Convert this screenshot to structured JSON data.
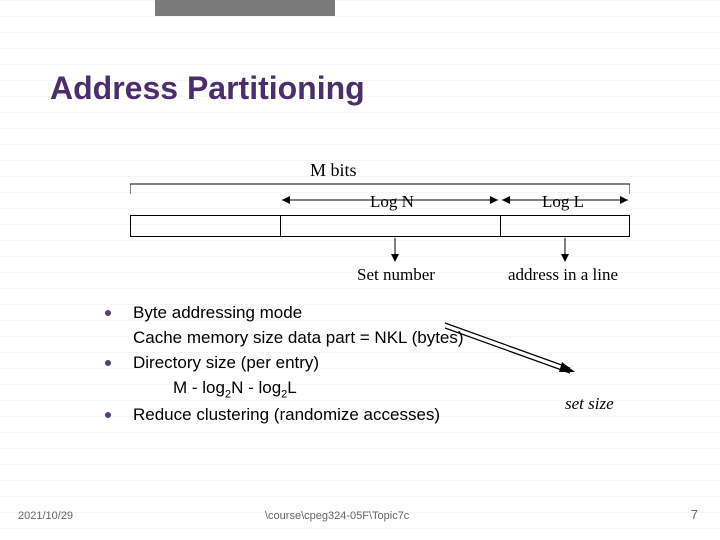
{
  "title": "Address Partitioning",
  "diagram": {
    "total_label": "M bits",
    "field1_label": "Log N",
    "field2_label": "Log L",
    "field1_desc": "Set number",
    "field2_desc": "address in a line"
  },
  "bullets": {
    "b1": "Byte addressing mode",
    "b1b": "Cache memory size data part = NKL (bytes)",
    "b2": "Directory size (per entry)",
    "b2b_prefix": "M - log",
    "b2b_mid": "N - log",
    "b2b_suffix": "L",
    "sub": "2",
    "b3": "Reduce clustering (randomize accesses)"
  },
  "annotation": "set size",
  "footer": {
    "date": "2021/10/29",
    "path": "\\course\\cpeg324-05F\\Topic7c",
    "page": "7"
  }
}
